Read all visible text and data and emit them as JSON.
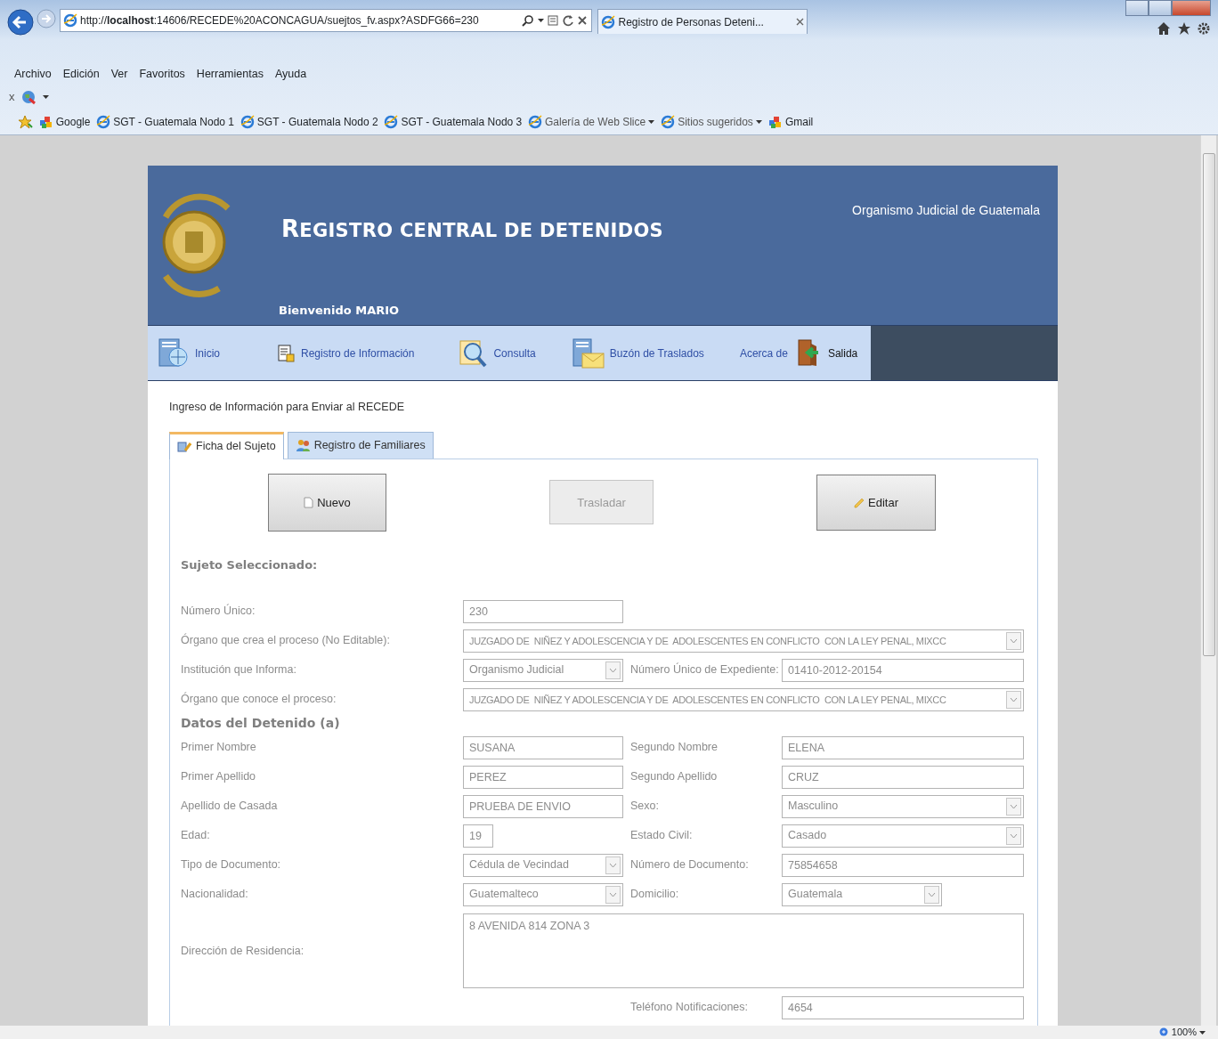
{
  "browser": {
    "url": "http://**localhost**:14606/RECEDE%20ACONCAGUA/suejtos_fv.aspx?ASDFG66=230",
    "tab": "Registro de Personas Deteni...",
    "menu": [
      "Archivo",
      "Edición",
      "Ver",
      "Favoritos",
      "Herramientas",
      "Ayuda"
    ],
    "toolbar_close": "x",
    "favorites": [
      {
        "label": "Google",
        "kind": "link"
      },
      {
        "label": "SGT - Guatemala Nodo 1",
        "kind": "link"
      },
      {
        "label": "SGT - Guatemala Nodo 2",
        "kind": "link"
      },
      {
        "label": "SGT - Guatemala Nodo 3",
        "kind": "link"
      },
      {
        "label": "Galería de Web Slice",
        "kind": "dropdown"
      },
      {
        "label": "Sitios sugeridos",
        "kind": "dropdown"
      },
      {
        "label": "Gmail",
        "kind": "link"
      }
    ],
    "zoom": "100%"
  },
  "header": {
    "title": "REGISTRO CENTRAL DE DETENIDOS",
    "organization": "Organismo Judicial de Guatemala",
    "welcome": "Bienvenido MARIO"
  },
  "nav": [
    {
      "label": "Inicio"
    },
    {
      "label": "Registro de Información"
    },
    {
      "label": "Consulta"
    },
    {
      "label": "Buzón de Traslados"
    },
    {
      "label": "Acerca de"
    },
    {
      "label": "Salida"
    }
  ],
  "intro": "Ingreso de Información para Enviar al RECEDE",
  "tabs": [
    {
      "label": "Ficha del Sujeto",
      "selected": true
    },
    {
      "label": "Registro de Familiares",
      "selected": false
    }
  ],
  "buttons": [
    {
      "label": "Nuevo",
      "disabled": false
    },
    {
      "label": "Trasladar",
      "disabled": true
    },
    {
      "label": "Editar",
      "disabled": false
    }
  ],
  "form": {
    "heading": "Sujeto Seleccionado:",
    "rows": [
      {
        "kind": "field",
        "label": "Número Único:",
        "input": {
          "kind": "text",
          "value": "230"
        }
      },
      {
        "kind": "field",
        "label": "Órgano que crea el proceso (No Editable):",
        "input": {
          "kind": "select",
          "value": "JUZGADO DE  NIÑEZ Y ADOLESCENCIA Y DE  ADOLESCENTES EN CONFLICTO  CON LA LEY PENAL, MIXCC"
        }
      },
      {
        "kind": "field",
        "label": "Institución que Informa:",
        "input": {
          "kind": "select",
          "value": "Organismo Judicial"
        },
        "label2": "Número Único de Expediente:",
        "input2": {
          "kind": "text",
          "value": "01410-2012-20154"
        }
      },
      {
        "kind": "field",
        "label": "Órgano que conoce el proceso:",
        "input": {
          "kind": "select",
          "value": "JUZGADO DE  NIÑEZ Y ADOLESCENCIA Y DE  ADOLESCENTES EN CONFLICTO  CON LA LEY PENAL, MIXCC"
        }
      },
      {
        "kind": "heading",
        "label": "Datos del Detenido (a)"
      },
      {
        "kind": "field",
        "label": "Primer Nombre",
        "input": {
          "kind": "text",
          "value": "SUSANA"
        },
        "label2": "Segundo Nombre",
        "input2": {
          "kind": "text",
          "value": "ELENA"
        }
      },
      {
        "kind": "field",
        "label": "Primer Apellido",
        "input": {
          "kind": "text",
          "value": "PEREZ"
        },
        "label2": "Segundo Apellido",
        "input2": {
          "kind": "text",
          "value": "CRUZ"
        }
      },
      {
        "kind": "field",
        "label": "Apellido de Casada",
        "input": {
          "kind": "text",
          "value": "PRUEBA DE ENVIO"
        },
        "label2": "Sexo:",
        "input2": {
          "kind": "select",
          "value": "Masculino"
        }
      },
      {
        "kind": "field",
        "label": "Edad:",
        "input": {
          "kind": "number",
          "value": "19"
        },
        "label2": "Estado Civil:",
        "input2": {
          "kind": "select",
          "value": "Casado"
        }
      },
      {
        "kind": "field",
        "label": "Tipo de Documento:",
        "input": {
          "kind": "select",
          "value": "Cédula de Vecindad"
        },
        "label2": "Número de Documento:",
        "input2": {
          "kind": "text",
          "value": "75854658"
        }
      },
      {
        "kind": "field",
        "label": "Nacionalidad:",
        "input": {
          "kind": "select",
          "value": "Guatemalteco"
        },
        "label2": "Domicilio:",
        "input2": {
          "kind": "short-select",
          "value": "Guatemala"
        }
      },
      {
        "kind": "field",
        "label": "Dirección de Residencia:",
        "input": {
          "kind": "textarea",
          "value": "8 AVENIDA 814 ZONA 3"
        }
      },
      {
        "kind": "field",
        "label2": "Teléfono Notificaciones:",
        "input2": {
          "kind": "text",
          "value": "4654"
        }
      }
    ]
  }
}
